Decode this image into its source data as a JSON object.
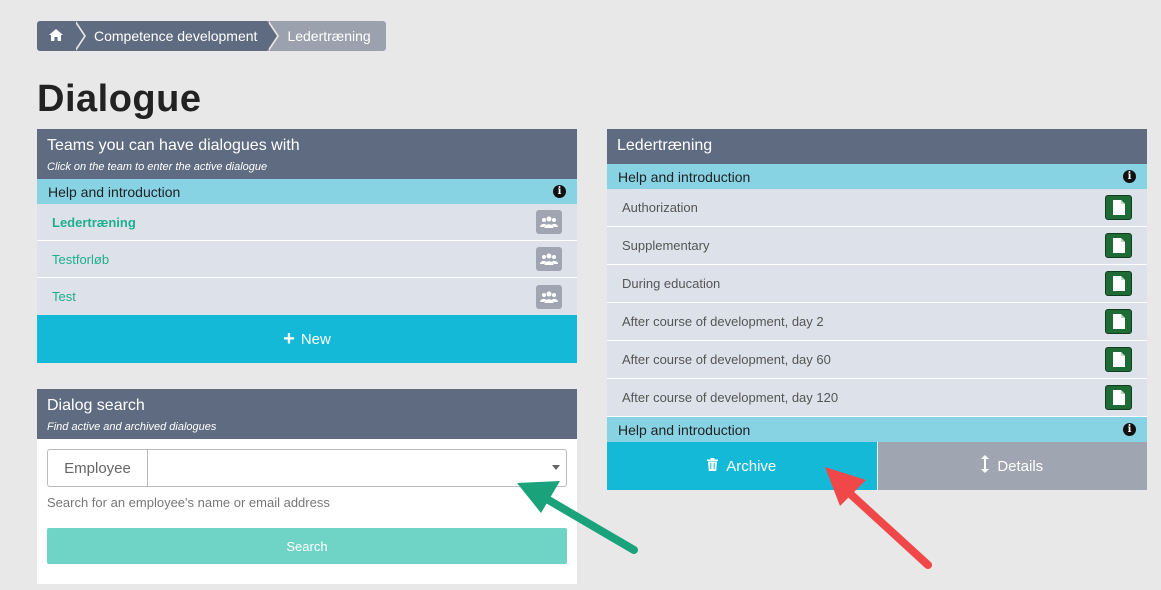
{
  "breadcrumb": {
    "items": [
      "Competence development",
      "Ledertræning"
    ]
  },
  "page_title": "Dialogue",
  "teams_panel": {
    "title": "Teams you can have dialogues with",
    "subtitle": "Click on the team to enter the active dialogue",
    "help_label": "Help and introduction",
    "teams": [
      {
        "label": "Ledertræning",
        "active": true
      },
      {
        "label": "Testforløb",
        "active": false
      },
      {
        "label": "Test",
        "active": false
      }
    ],
    "new_label": "New"
  },
  "search_panel": {
    "title": "Dialog search",
    "subtitle": "Find active and archived dialogues",
    "field_label": "Employee",
    "field_value": "",
    "hint": "Search for an employee's name or email address",
    "button_label": "Search"
  },
  "dialogue_panel": {
    "title": "Ledertræning",
    "help_top_label": "Help and introduction",
    "documents": [
      "Authorization",
      "Supplementary",
      "During education",
      "After course of development, day 2",
      "After course of development, day 60",
      "After course of development, day 120"
    ],
    "help_bottom_label": "Help and introduction",
    "archive_label": "Archive",
    "details_label": "Details"
  },
  "colors": {
    "header": "#5f6b80",
    "help_row": "#87d3e4",
    "primary": "#15b9d8",
    "team_link": "#1fae8e",
    "doc_button": "#1f6b35",
    "green_arrow": "#1aa37a",
    "red_arrow": "#f04848"
  }
}
